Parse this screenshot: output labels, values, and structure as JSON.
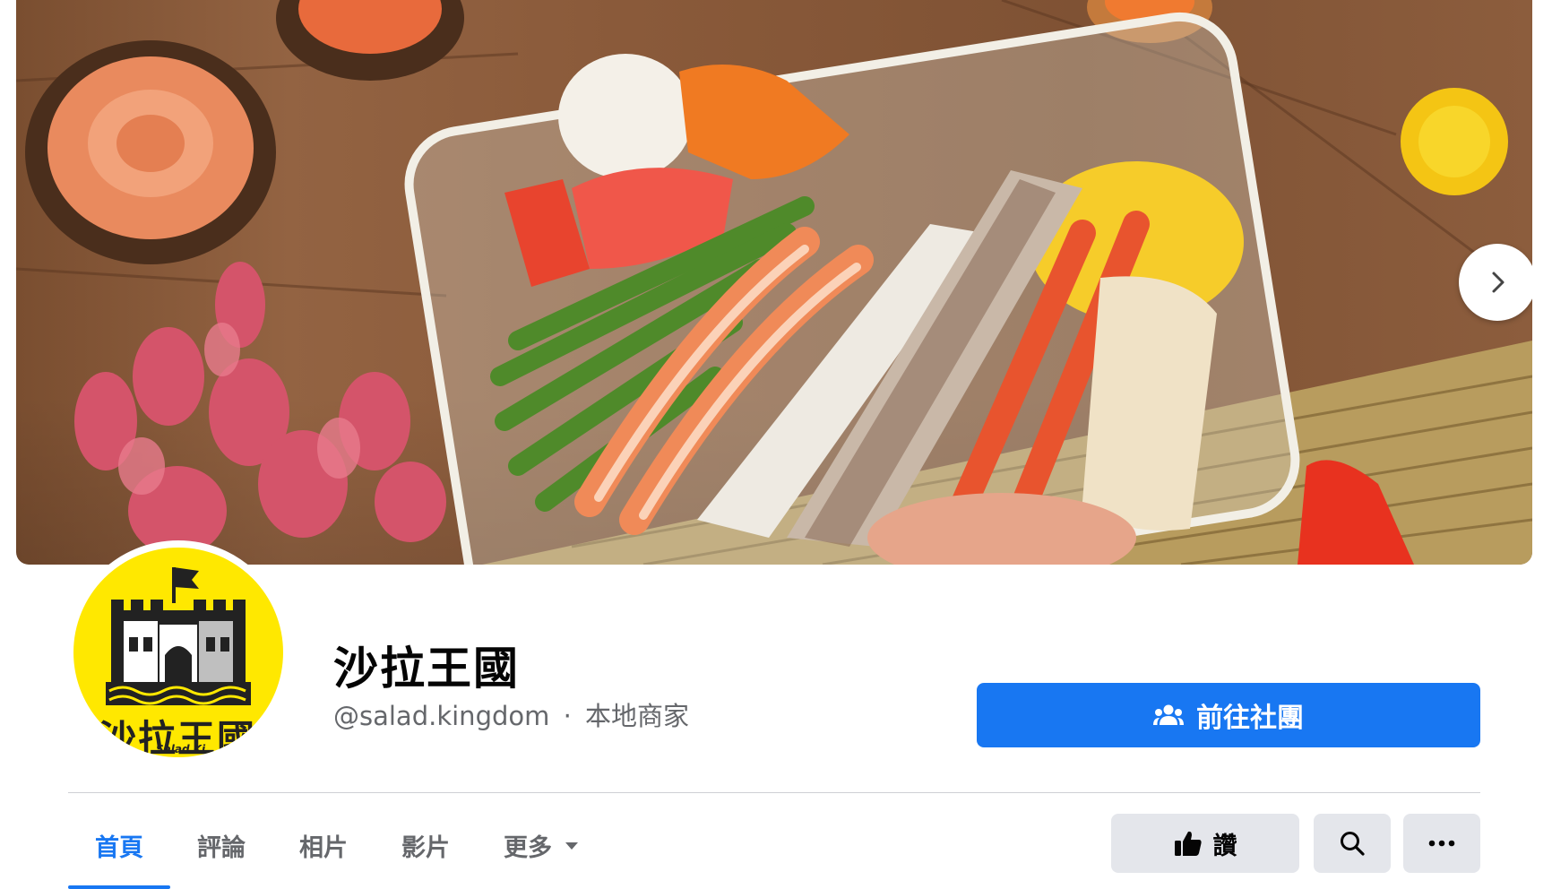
{
  "cover": {
    "next_label": "next-photo"
  },
  "profile": {
    "name": "沙拉王國",
    "handle": "@salad.kingdom",
    "separator": "·",
    "category": "本地商家",
    "logo_text": "沙拉王國",
    "logo_sub": "Salad Ki"
  },
  "primary_action": {
    "label": "前往社團"
  },
  "tabs": [
    {
      "label": "首頁",
      "active": true
    },
    {
      "label": "評論",
      "active": false
    },
    {
      "label": "相片",
      "active": false
    },
    {
      "label": "影片",
      "active": false
    },
    {
      "label": "更多",
      "active": false
    }
  ],
  "actions": {
    "like_label": "讚"
  },
  "colors": {
    "accent": "#1877f2",
    "secondary_bg": "#e4e6eb",
    "muted_text": "#65676b",
    "logo_yellow": "#ffe800"
  }
}
